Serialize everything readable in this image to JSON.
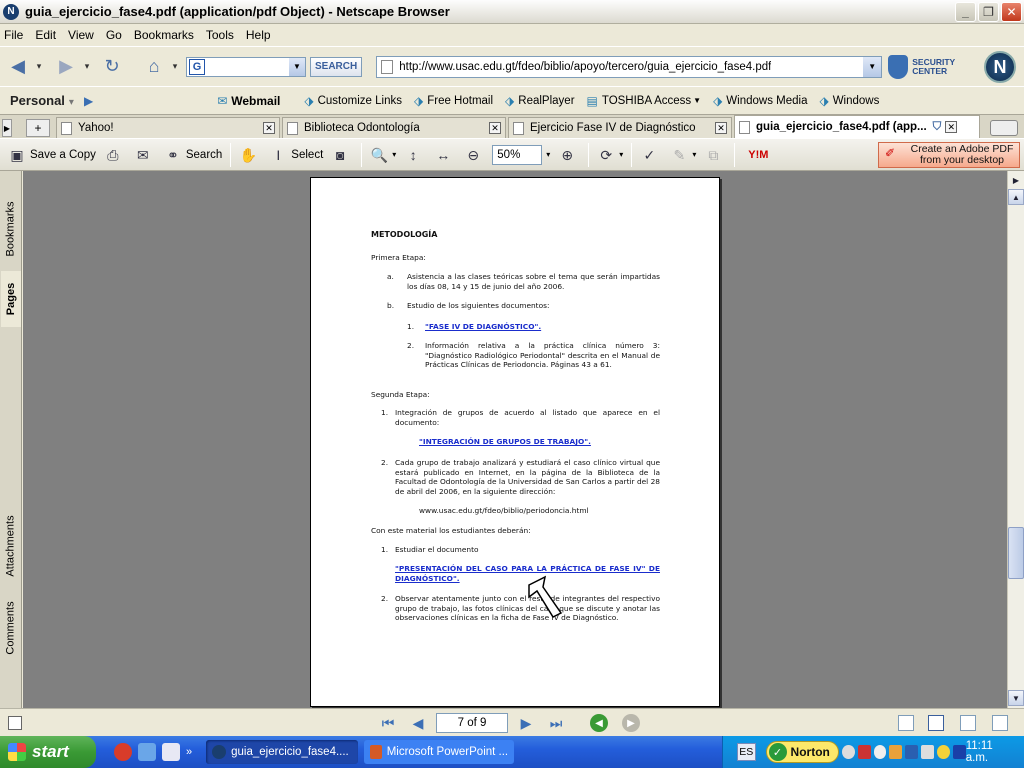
{
  "window": {
    "title": "guia_ejercicio_fase4.pdf (application/pdf Object) - Netscape Browser"
  },
  "menubar": [
    "File",
    "Edit",
    "View",
    "Go",
    "Bookmarks",
    "Tools",
    "Help"
  ],
  "navbar": {
    "search_button": "SEARCH",
    "url": "http://www.usac.edu.gt/fdeo/biblio/apoyo/tercero/guia_ejercicio_fase4.pdf",
    "security_line1": "SECURITY",
    "security_line2": "CENTER",
    "logo_letter": "N"
  },
  "personalbar": {
    "personal": "Personal",
    "items": [
      "Webmail",
      "Customize Links",
      "Free Hotmail",
      "RealPlayer",
      "TOSHIBA Access",
      "Windows Media",
      "Windows"
    ]
  },
  "tabs": [
    {
      "label": "Yahoo!"
    },
    {
      "label": "Biblioteca Odontología"
    },
    {
      "label": "Ejercicio Fase IV de Diagnóstico"
    },
    {
      "label": "guia_ejercicio_fase4.pdf (app..."
    }
  ],
  "acrobat": {
    "save_copy": "Save a Copy",
    "search": "Search",
    "select": "Select",
    "zoom": "50%",
    "create_pdf_line1": "Create an Adobe PDF",
    "create_pdf_line2": "from your desktop"
  },
  "sidepanel": {
    "tabs": [
      "Bookmarks",
      "Pages",
      "Attachments",
      "Comments"
    ]
  },
  "document": {
    "heading": "METODOLOGÍA",
    "stage1": "Primera Etapa:",
    "a_marker": "a.",
    "a_text": "Asistencia a las clases teóricas sobre el tema que serán impartidas los días 08, 14 y 15 de junio del año 2006.",
    "b_marker": "b.",
    "b_text": "Estudio de los siguientes documentos:",
    "b1_marker": "1.",
    "b1_link": "\"FASE IV DE DIAGNÓSTICO\".",
    "b2_marker": "2.",
    "b2_text": "Información relativa a la práctica clínica número 3: \"Diagnóstico Radiológico Periodontal\" descrita en el Manual de Prácticas Clínicas de Periodoncia. Páginas 43 a 61.",
    "stage2": "Segunda Etapa:",
    "s1_marker": "1.",
    "s1_text": "Integración de grupos de acuerdo al listado que aparece en el documento:",
    "s1_link": "\"INTEGRACIÓN DE GRUPOS DE TRABAJO\".",
    "s2_marker": "2.",
    "s2_text": "Cada grupo de trabajo analizará y estudiará el caso clínico virtual que estará publicado en Internet, en la página de la Biblioteca de la Facultad de Odontología de la Universidad de San Carlos a partir del 28 de abril del 2006, en la siguiente dirección:",
    "s2_url": "www.usac.edu.gt/fdeo/biblio/periodoncia.html",
    "with_material": "Con este material los estudiantes deberán:",
    "m1_marker": "1.",
    "m1_text": "Estudiar el documento",
    "m1_link": "\"PRESENTACIÓN DEL CASO PARA LA PRÁCTICA DE FASE IV\" DE DIAGNÓSTICO\".",
    "m2_marker": "2.",
    "m2_text": "Observar atentamente junto con el resto de integrantes del respectivo grupo de trabajo, las fotos clínicas del caso que se discute y anotar las observaciones clínicas en la ficha de Fase IV de Diagnóstico."
  },
  "statusbar": {
    "page": "7 of 9"
  },
  "taskbar": {
    "start": "start",
    "tasks": [
      "guia_ejercicio_fase4....",
      "Microsoft PowerPoint ..."
    ],
    "lang": "ES",
    "norton": "Norton",
    "clock": "11:11 a.m."
  },
  "colors": {
    "link": "#1a2dcc",
    "doc_background": "#808080",
    "taskbar": "#245edb",
    "start": "#3a9a35"
  }
}
